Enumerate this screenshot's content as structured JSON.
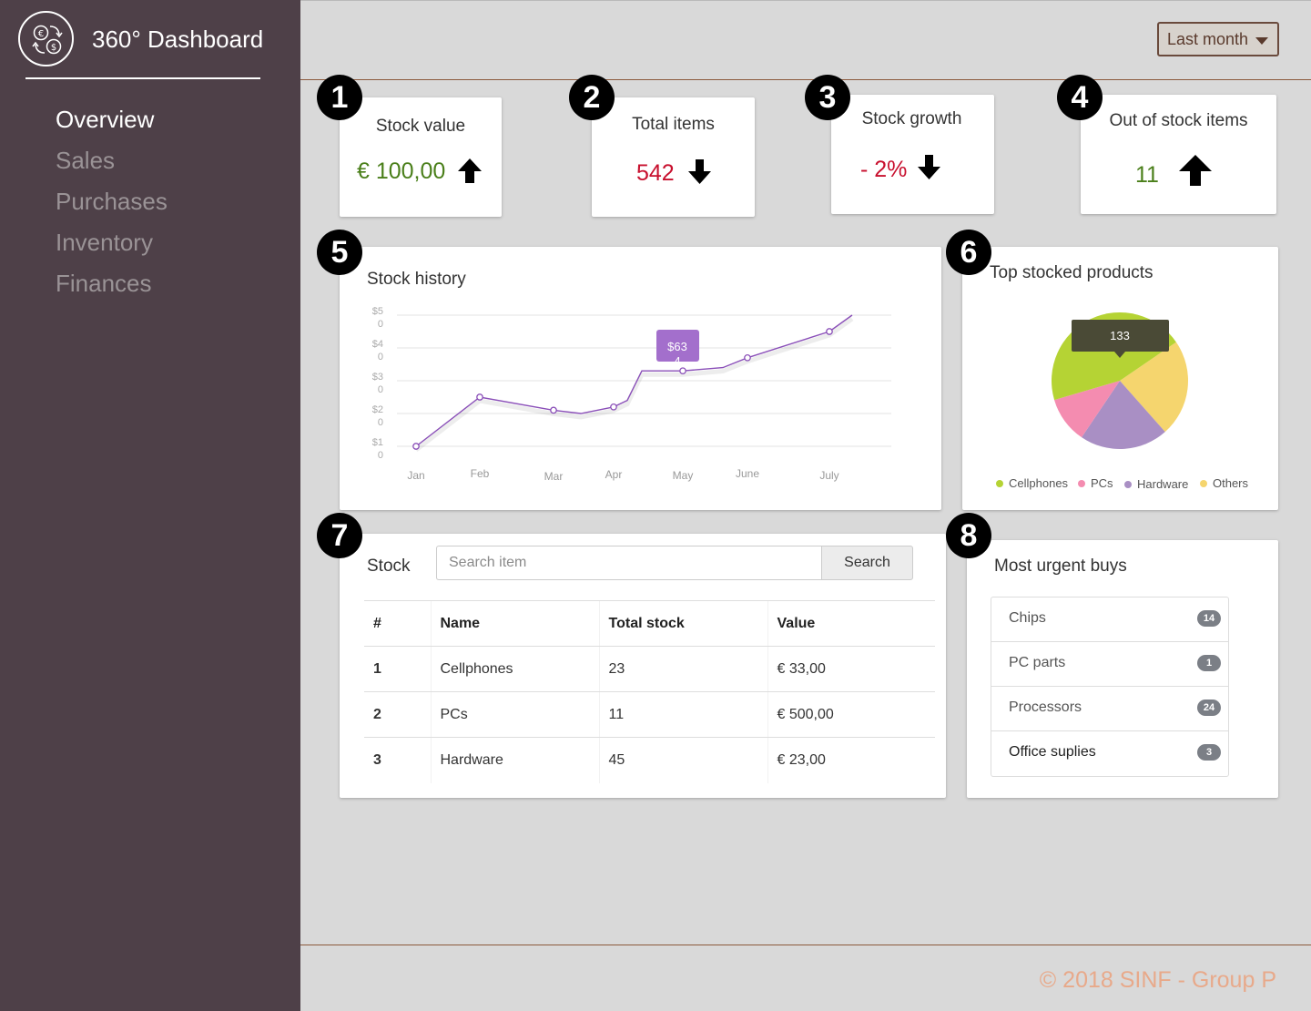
{
  "app": {
    "title": "360°  Dashboard"
  },
  "sidebar": {
    "items": [
      {
        "label": "Overview",
        "active": true
      },
      {
        "label": "Sales"
      },
      {
        "label": "Purchases"
      },
      {
        "label": "Inventory"
      },
      {
        "label": "Finances"
      }
    ]
  },
  "header": {
    "period_label": "Last month"
  },
  "badges": [
    "1",
    "2",
    "3",
    "4",
    "5",
    "6",
    "7",
    "8"
  ],
  "kpis": [
    {
      "title": "Stock value",
      "value": "€ 100,00",
      "trend": "up",
      "color": "#4a7f1a"
    },
    {
      "title": "Total items",
      "value": "542",
      "trend": "down",
      "color": "#c8102e"
    },
    {
      "title": "Stock growth",
      "value": "- 2%",
      "trend": "down",
      "color": "#c8102e"
    },
    {
      "title": "Out of stock items",
      "value": "11",
      "trend": "up",
      "color": "#4a7f1a"
    }
  ],
  "stock_history": {
    "title": "Stock history",
    "y_ticks": [
      {
        "a": "$5",
        "b": "0"
      },
      {
        "a": "$4",
        "b": "0"
      },
      {
        "a": "$3",
        "b": "0"
      },
      {
        "a": "$2",
        "b": "0"
      },
      {
        "a": "$1",
        "b": "0"
      }
    ],
    "x_labels": [
      "Jan",
      "Feb",
      "Mar",
      "Apr",
      "May",
      "June",
      "July"
    ],
    "tooltip": {
      "line1": "$63",
      "line2": "4"
    },
    "line_color": "#8a4fb8"
  },
  "chart_data": [
    {
      "type": "line",
      "title": "Stock history",
      "categories": [
        "Jan",
        "Feb",
        "Mar",
        "Apr",
        "May",
        "June",
        "July"
      ],
      "y_tick_labels": [
        "$50",
        "$40",
        "$30",
        "$20",
        "$10"
      ],
      "ylim": [
        10,
        50
      ],
      "points": [
        {
          "x": "Jan",
          "y": 10
        },
        {
          "x": "Feb",
          "y": 25
        },
        {
          "x": "Mar",
          "y": 21
        },
        {
          "x": "Mar-Apr",
          "y": 20
        },
        {
          "x": "Apr",
          "y": 22
        },
        {
          "x": "Apr-May",
          "y": 24
        },
        {
          "x": "Apr-May",
          "y": 33
        },
        {
          "x": "May",
          "y": 33
        },
        {
          "x": "May-June",
          "y": 34
        },
        {
          "x": "June",
          "y": 37
        },
        {
          "x": "July",
          "y": 45
        },
        {
          "x": "July+",
          "y": 50
        }
      ],
      "marked_points": [
        0,
        1,
        2,
        4,
        7,
        9,
        10
      ],
      "tooltip": "$634",
      "grid": true
    },
    {
      "type": "pie",
      "title": "Top stocked products",
      "slices": [
        {
          "label": "Cellphones",
          "value": 45,
          "color": "#b5d334"
        },
        {
          "label": "PCs",
          "value": 11,
          "color": "#f48cb0"
        },
        {
          "label": "Hardware",
          "value": 21,
          "color": "#a98fc4"
        },
        {
          "label": "Others",
          "value": 23,
          "color": "#f5d56e"
        }
      ],
      "tooltip": "133",
      "legend": "bottom"
    }
  ],
  "pie": {
    "title": "Top stocked products",
    "tooltip": "133",
    "legend": [
      {
        "label": "Cellphones",
        "color": "#b5d334"
      },
      {
        "label": "PCs",
        "color": "#f48cb0"
      },
      {
        "label": "Hardware",
        "color": "#a98fc4"
      },
      {
        "label": "Others",
        "color": "#f5d56e"
      }
    ]
  },
  "stock": {
    "title": "Stock",
    "search_placeholder": "Search item",
    "search_button": "Search",
    "columns": [
      "#",
      "Name",
      "Total stock",
      "Value"
    ],
    "rows": [
      [
        "1",
        "Cellphones",
        "23",
        "€ 33,00"
      ],
      [
        "2",
        "PCs",
        "11",
        "€ 500,00"
      ],
      [
        "3",
        "Hardware",
        "45",
        "€ 23,00"
      ]
    ]
  },
  "urgent": {
    "title": "Most urgent buys",
    "items": [
      {
        "label": "Chips",
        "count": "14"
      },
      {
        "label": "PC parts",
        "count": "1"
      },
      {
        "label": "Processors",
        "count": "24"
      },
      {
        "label": "Office suplies",
        "count": "3"
      }
    ]
  },
  "footer": {
    "text": "© 2018 SINF - Group P"
  },
  "icons": {
    "logo": "currency-exchange-icon",
    "up": "arrow-up-icon",
    "down": "arrow-down-icon",
    "caret": "caret-down-icon"
  }
}
